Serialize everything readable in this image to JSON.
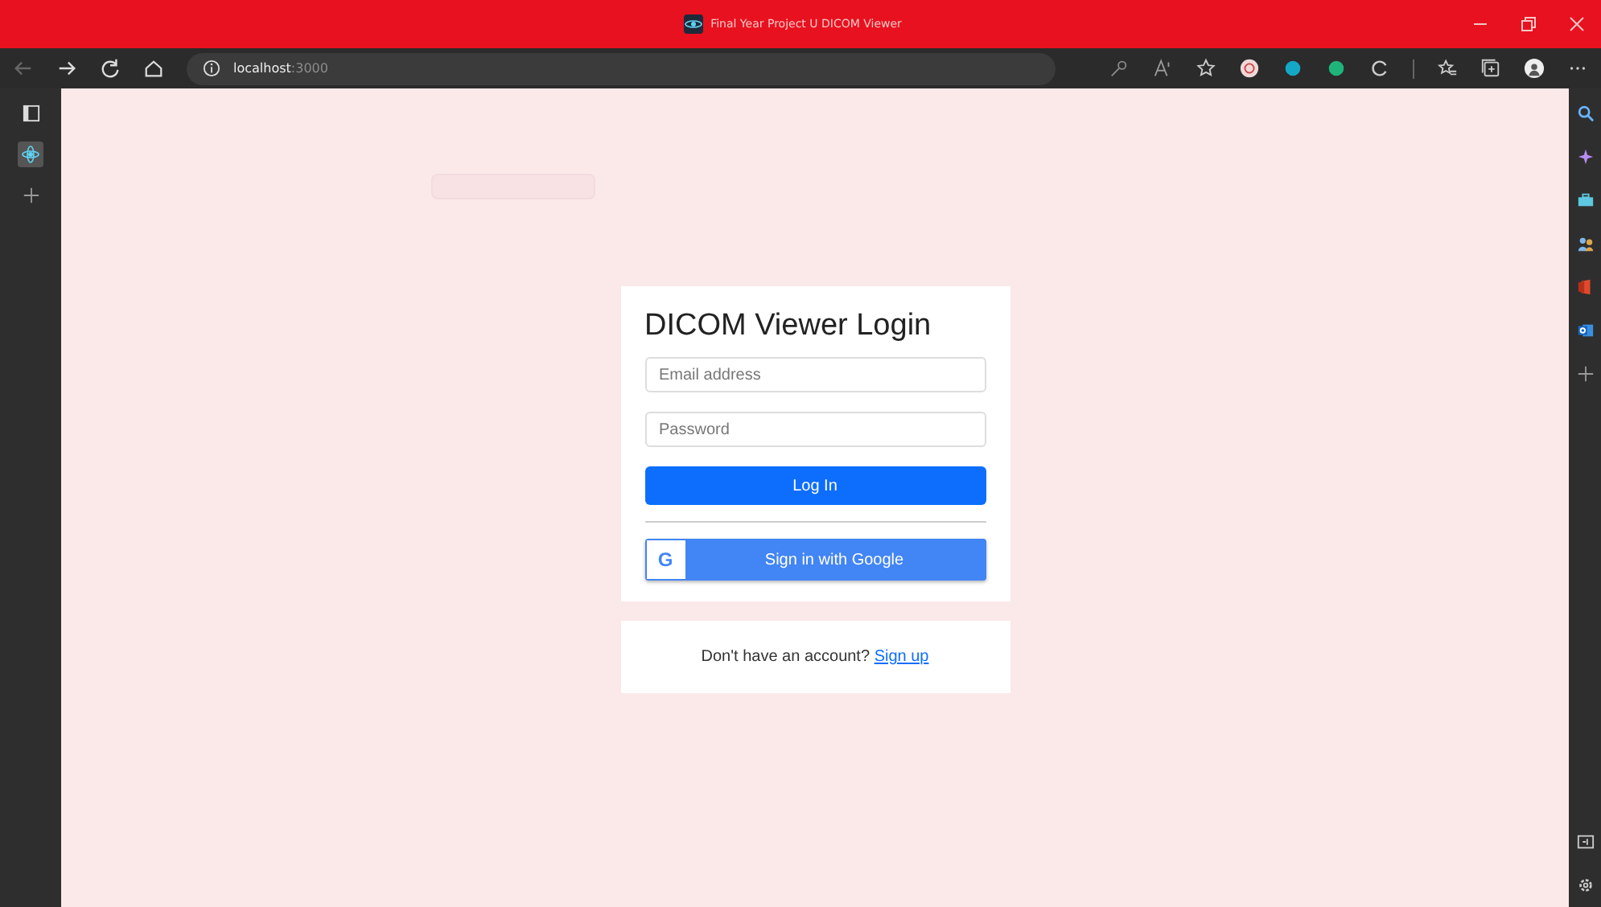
{
  "window": {
    "title": "Final Year Project U DICOM Viewer"
  },
  "address_bar": {
    "host": "localhost",
    "port": ":3000"
  },
  "login_card": {
    "title": "DICOM Viewer Login",
    "email": {
      "placeholder": "Email address"
    },
    "password": {
      "placeholder": "Password"
    },
    "login_button": "Log In",
    "google_button": "Sign in with Google",
    "google_letter": "G"
  },
  "signup_card": {
    "text": "Don't have an account?",
    "link": "Sign up"
  }
}
